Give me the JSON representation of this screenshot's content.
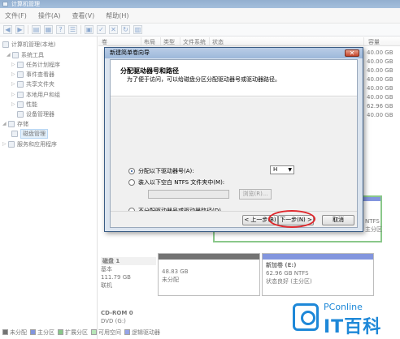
{
  "window": {
    "title": "计算机管理"
  },
  "menu": [
    "文件(F)",
    "操作(A)",
    "查看(V)",
    "帮助(H)"
  ],
  "tree": {
    "items": [
      {
        "label": "计算机管理(本地)",
        "icon": "computer-icon"
      },
      {
        "label": "系统工具",
        "icon": "tools-icon"
      },
      {
        "label": "任务计划程序",
        "icon": "clock-icon"
      },
      {
        "label": "事件查看器",
        "icon": "event-icon"
      },
      {
        "label": "共享文件夹",
        "icon": "folder-icon"
      },
      {
        "label": "本地用户和组",
        "icon": "users-icon"
      },
      {
        "label": "性能",
        "icon": "performance-icon"
      },
      {
        "label": "设备管理器",
        "icon": "device-icon"
      },
      {
        "label": "存储",
        "icon": "storage-icon"
      },
      {
        "label": "磁盘管理",
        "icon": "disk-icon"
      },
      {
        "label": "服务和应用程序",
        "icon": "services-icon"
      }
    ]
  },
  "list": {
    "columns": [
      "卷",
      "布局",
      "类型",
      "文件系统",
      "状态",
      "容量"
    ],
    "capacities": [
      "40.00 GB",
      "40.00 GB",
      "40.00 GB",
      "40.00 GB",
      "40.00 GB",
      "40.00 GB",
      "62.96 GB",
      "40.00 GB"
    ]
  },
  "diskmap": {
    "disk1": {
      "name": "磁盘 1",
      "type": "基本",
      "size": "111.79 GB",
      "status": "联机"
    },
    "p1": {
      "size": "48.83 GB",
      "status": "未分配"
    },
    "p2": {
      "name": "新加卷 (E:)",
      "size": "62.96 GB NTFS",
      "status": "状态良好 (主分区)"
    },
    "ntfs": "NTFS",
    "ntfs_status": "主分区",
    "cdrom": {
      "name": "CD-ROM 0",
      "drive": "DVD (G:)"
    }
  },
  "legend": [
    {
      "label": "未分配",
      "color": "#000000"
    },
    {
      "label": "主分区",
      "color": "#1d3fc4"
    },
    {
      "label": "扩展分区",
      "color": "#2b9c2b"
    },
    {
      "label": "可用空间",
      "color": "#7fd17f"
    },
    {
      "label": "逻辑驱动器",
      "color": "#3f5ad8"
    }
  ],
  "dialog": {
    "title": "新建简单卷向导",
    "close": "✕",
    "heading": "分配驱动器号和路径",
    "description": "为了便于访问，可以给磁盘分区分配驱动器号或驱动器路径。",
    "options": [
      "分配以下驱动器号(A):",
      "装入以下空白 NTFS 文件夹中(M):",
      "不分配驱动器号或驱动器路径(D)"
    ],
    "drive_letter": "H",
    "browse": "浏览(R)...",
    "back": "< 上一步(B)",
    "next": "下一步(N) >",
    "cancel": "取消"
  },
  "watermark": {
    "top": "PConline",
    "bottom": "IT百科"
  }
}
